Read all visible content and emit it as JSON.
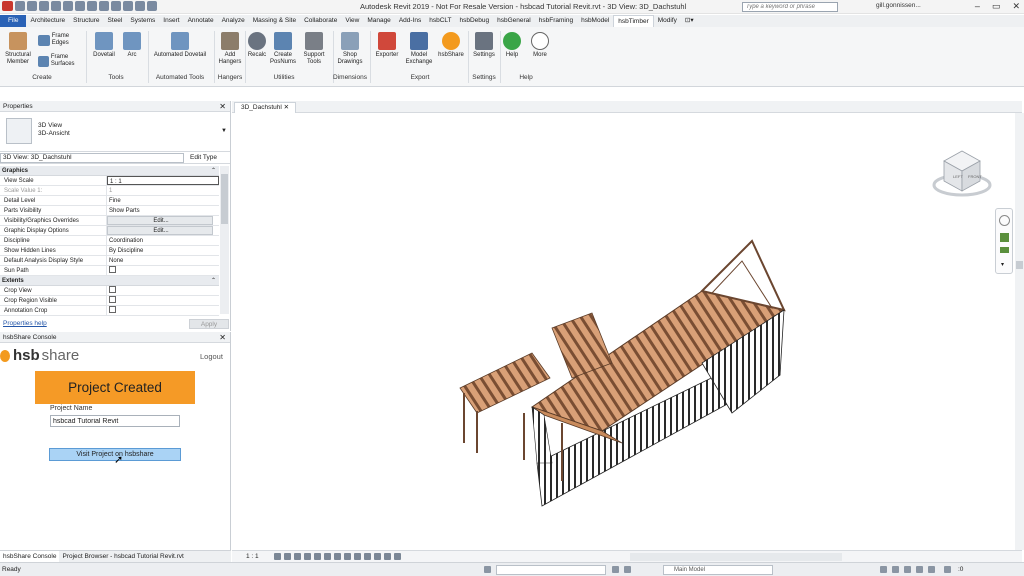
{
  "titlebar": {
    "title": "Autodesk Revit 2019 - Not For Resale Version - hsbcad Tutorial Revit.rvt - 3D View: 3D_Dachstuhl",
    "search_placeholder": "Type a keyword or phrase",
    "user": "gill.gonnissen..."
  },
  "tabs": [
    "File",
    "Architecture",
    "Structure",
    "Steel",
    "Systems",
    "Insert",
    "Annotate",
    "Analyze",
    "Massing & Site",
    "Collaborate",
    "View",
    "Manage",
    "Add-Ins",
    "hsbCLT",
    "hsbDebug",
    "hsbGeneral",
    "hsbFraming",
    "hsbModel",
    "hsbTimber",
    "Modify"
  ],
  "active_tab": "hsbTimber",
  "ribbon": {
    "structural_member": "Structural Member",
    "frame_edges": "Frame Edges",
    "frame_surfaces": "Frame Surfaces",
    "dovetail": "Dovetail",
    "arc": "Arc",
    "automated_dovetail": "Automated Dovetail",
    "add_hangers": "Add Hangers",
    "recalc": "Recalc",
    "create_posnums": "Create PosNums",
    "support_tools": "Support Tools",
    "shop_drawings": "Shop Drawings",
    "exporter": "Exporter",
    "model_exchange": "Model Exchange",
    "hsbshare": "hsbShare",
    "settings": "Settings",
    "help": "Help",
    "more": "More",
    "panels": {
      "create": "Create",
      "tools": "Tools",
      "automated_tools": "Automated Tools",
      "hangers": "Hangers",
      "utilities": "Utilities",
      "dimensions": "Dimensions",
      "export": "Export",
      "settings": "Settings",
      "help": "Help"
    }
  },
  "properties": {
    "title": "Properties",
    "type_line1": "3D View",
    "type_line2": "3D-Ansicht",
    "instance": "3D View: 3D_Dachstuhl",
    "edit_type": "Edit Type",
    "groups": {
      "graphics": "Graphics",
      "extents": "Extents"
    },
    "rows": {
      "view_scale": {
        "k": "View Scale",
        "v": "1 : 1"
      },
      "scale_value": {
        "k": "Scale Value    1:",
        "v": "1"
      },
      "detail_level": {
        "k": "Detail Level",
        "v": "Fine"
      },
      "parts_visibility": {
        "k": "Parts Visibility",
        "v": "Show Parts"
      },
      "vg_overrides": {
        "k": "Visibility/Graphics Overrides",
        "v": "Edit..."
      },
      "graphic_display": {
        "k": "Graphic Display Options",
        "v": "Edit..."
      },
      "discipline": {
        "k": "Discipline",
        "v": "Coordination"
      },
      "hidden_lines": {
        "k": "Show Hidden Lines",
        "v": "By Discipline"
      },
      "analysis_style": {
        "k": "Default Analysis Display Style",
        "v": "None"
      },
      "sun_path": {
        "k": "Sun Path",
        "v": ""
      },
      "crop_view": {
        "k": "Crop View",
        "v": ""
      },
      "crop_region": {
        "k": "Crop Region Visible",
        "v": ""
      },
      "annotation_crop": {
        "k": "Annotation Crop",
        "v": ""
      }
    },
    "help_link": "Properties help",
    "apply": "Apply"
  },
  "console": {
    "title": "hsbShare Console",
    "logo_hsb": "hsb",
    "logo_share": "share",
    "logout": "Logout",
    "banner": "Project Created",
    "project_name_label": "Project Name",
    "project_name_value": "hsbcad Tutorial Revit",
    "visit_button": "Visit Project on hsbshare"
  },
  "left_tabs": {
    "console": "hsbShare Console",
    "browser": "Project Browser - hsbcad Tutorial Revit.rvt"
  },
  "view": {
    "tab": "3D_Dachstuhl",
    "scale": "1 : 1",
    "viewcube_left": "LEFT",
    "viewcube_front": "FRONT"
  },
  "status": {
    "text": "Ready",
    "model": "Main Model"
  },
  "colors": {
    "accent": "#2a62b6",
    "banner": "#f59a26",
    "button": "#aad3f5",
    "timber": "#c98b5c",
    "timber_dark": "#6b4630"
  }
}
